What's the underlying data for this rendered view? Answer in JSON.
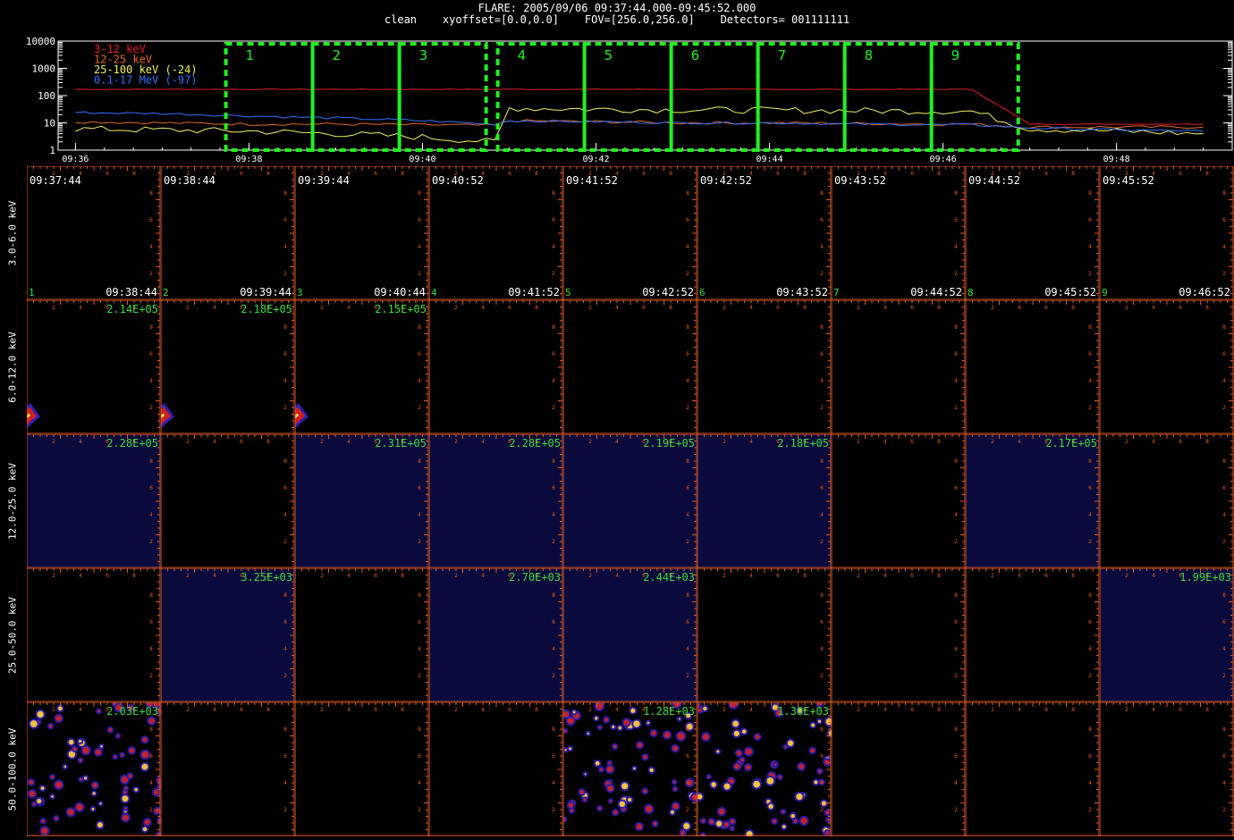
{
  "header": {
    "title": "FLARE: 2005/09/06 09:37:44.000-09:45:52.000",
    "subtitle": "clean    xyoffset=[0.0,0.0]    FOV=[256.0,256.0]    Detectors= 001111111"
  },
  "lightcurve": {
    "legend": [
      {
        "label": "3-12 keV",
        "color": "#e02020"
      },
      {
        "label": "12-25 keV",
        "color": "#e06a20"
      },
      {
        "label": "25-100 keV (-24)",
        "color": "#f0f060"
      },
      {
        "label": "0.1-17 MeV (-97)",
        "color": "#3070ff"
      }
    ],
    "y_tick_labels": [
      "10000",
      "1000",
      "100",
      "10",
      "1"
    ],
    "x_tick_labels": [
      "09:36",
      "09:38",
      "09:40",
      "09:42",
      "09:44",
      "09:46",
      "09:48"
    ],
    "interval_labels": [
      "1",
      "2",
      "3",
      "4",
      "5",
      "6",
      "7",
      "8",
      "9"
    ],
    "interval_color": "#22ee22"
  },
  "chart_data": {
    "type": "line",
    "ylabel": "",
    "yscale": "log",
    "ylim": [
      1,
      10000
    ],
    "x": [
      "09:36",
      "09:37",
      "09:38",
      "09:39",
      "09:40",
      "09:40:50",
      "09:41",
      "09:42",
      "09:43",
      "09:44",
      "09:45",
      "09:46",
      "09:46:20",
      "09:47",
      "09:48",
      "09:49"
    ],
    "series": [
      {
        "name": "3-12 keV",
        "values": [
          170,
          170,
          170,
          170,
          170,
          170,
          170,
          170,
          170,
          170,
          170,
          170,
          170,
          9,
          9,
          9
        ]
      },
      {
        "name": "12-25 keV",
        "values": [
          11,
          10,
          9,
          9,
          8.5,
          8,
          12,
          11,
          10,
          10,
          9.5,
          9,
          9,
          7,
          7,
          7
        ]
      },
      {
        "name": "25-100 keV (-24)",
        "values": [
          6,
          5.5,
          5,
          4,
          3,
          2,
          35,
          32,
          30,
          29,
          28,
          27,
          27,
          6,
          5,
          4
        ]
      },
      {
        "name": "0.1-17 MeV (-97)",
        "values": [
          24,
          22,
          18,
          15,
          12,
          9,
          12,
          11,
          10,
          10,
          9,
          8.5,
          8.5,
          6.5,
          5.5,
          5
        ]
      }
    ],
    "intervals": [
      {
        "label": "1",
        "start": "09:37:44",
        "end": "09:38:44"
      },
      {
        "label": "2",
        "start": "09:38:44",
        "end": "09:39:44"
      },
      {
        "label": "3",
        "start": "09:39:44",
        "end": "09:40:44"
      },
      {
        "label": "4",
        "start": "09:40:52",
        "end": "09:41:52"
      },
      {
        "label": "5",
        "start": "09:41:52",
        "end": "09:42:52"
      },
      {
        "label": "6",
        "start": "09:42:52",
        "end": "09:43:52"
      },
      {
        "label": "7",
        "start": "09:43:52",
        "end": "09:44:52"
      },
      {
        "label": "8",
        "start": "09:44:52",
        "end": "09:45:52"
      },
      {
        "label": "9",
        "start": "09:45:52",
        "end": "09:46:52"
      }
    ]
  },
  "image_grid": {
    "energy_bands": [
      "3.0-6.0 keV",
      "6.0-12.0 keV",
      "12.0-25.0 keV",
      "25.0-50.0 keV",
      "50.0-100.0 keV"
    ],
    "start_times": [
      "09:37:44",
      "09:38:44",
      "09:39:44",
      "09:40:52",
      "09:41:52",
      "09:42:52",
      "09:43:52",
      "09:44:52",
      "09:45:52"
    ],
    "end_times": [
      "09:38:44",
      "09:39:44",
      "09:40:44",
      "09:41:52",
      "09:42:52",
      "09:43:52",
      "09:44:52",
      "09:45:52",
      "09:46:52"
    ],
    "interval_numbers": [
      "1",
      "2",
      "3",
      "4",
      "5",
      "6",
      "7",
      "8",
      "9"
    ],
    "axis_tick_labels": [
      "2",
      "4",
      "6",
      "8"
    ],
    "peaks": [
      [
        "",
        "",
        "",
        "",
        "",
        "",
        "",
        "",
        ""
      ],
      [
        "2.14E+05",
        "2.18E+05",
        "2.15E+05",
        "",
        "",
        "",
        "",
        "",
        ""
      ],
      [
        "2.28E+05",
        "",
        "2.31E+05",
        "2.28E+05",
        "2.19E+05",
        "2.18E+05",
        "",
        "2.17E+05",
        ""
      ],
      [
        "",
        "3.25E+03",
        "",
        "2.70E+03",
        "2.44E+03",
        "",
        "",
        "",
        "1.99E+03"
      ],
      [
        "2.03E+03",
        "",
        "",
        "",
        "1.28E+03",
        "1.30E+03",
        "",
        "",
        ""
      ]
    ],
    "fill": [
      [
        "none",
        "none",
        "none",
        "none",
        "none",
        "none",
        "none",
        "none",
        "none"
      ],
      [
        "arcs",
        "arcs",
        "arcs",
        "none",
        "none",
        "none",
        "none",
        "none",
        "none"
      ],
      [
        "navy",
        "none",
        "navy",
        "navy",
        "navy",
        "navy",
        "none",
        "navy",
        "none"
      ],
      [
        "none",
        "navy",
        "none",
        "navy",
        "navy",
        "none",
        "none",
        "none",
        "navy"
      ],
      [
        "speckle",
        "none",
        "none",
        "none",
        "speckle",
        "speckle",
        "none",
        "none",
        "none"
      ]
    ],
    "colors": {
      "axis": "#e05a20",
      "navy": "#0a0a3c",
      "label": "#3ddc3d"
    }
  }
}
